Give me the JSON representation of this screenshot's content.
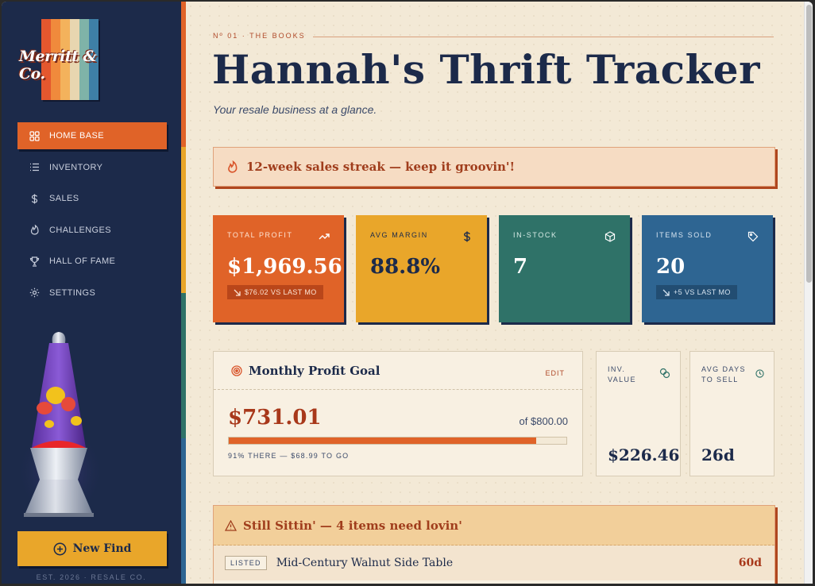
{
  "brand": {
    "logo_text": "Merritt & Co.",
    "logo_colors": [
      "#e4572e",
      "#f08a3c",
      "#f3b25c",
      "#e8d6b0",
      "#7fb3a8",
      "#3e7fa6"
    ],
    "tagline": "EST. 2026 · RESALE CO."
  },
  "colors": {
    "navy": "#1c2a4a",
    "orange": "#e06328",
    "mustard": "#e9a62a",
    "teal": "#2f7268",
    "blue": "#2e6592",
    "cream": "#f3e9d6",
    "rust": "#a8381a"
  },
  "nav": {
    "items": [
      {
        "label": "HOME BASE",
        "icon": "dashboard-icon",
        "active": true
      },
      {
        "label": "INVENTORY",
        "icon": "list-icon"
      },
      {
        "label": "SALES",
        "icon": "dollar-icon"
      },
      {
        "label": "CHALLENGES",
        "icon": "flame-icon"
      },
      {
        "label": "HALL OF FAME",
        "icon": "trophy-icon"
      },
      {
        "label": "SETTINGS",
        "icon": "gear-icon"
      }
    ],
    "new_find_label": "New Find"
  },
  "header": {
    "kicker": "Nº 01 · THE BOOKS",
    "title": "Hannah's Thrift Tracker",
    "subtitle": "Your resale business at a glance."
  },
  "streak": {
    "text": "12-week sales streak — keep it groovin'!"
  },
  "stats": [
    {
      "label": "TOTAL PROFIT",
      "value": "$1,969.56",
      "badge": "$76.02 VS LAST MO",
      "icon": "trend-up-icon"
    },
    {
      "label": "AVG MARGIN",
      "value": "88.8%",
      "icon": "dollar-icon"
    },
    {
      "label": "IN-STOCK",
      "value": "7",
      "icon": "box-icon"
    },
    {
      "label": "ITEMS SOLD",
      "value": "20",
      "badge": "+5 VS LAST MO",
      "icon": "tag-icon"
    }
  ],
  "goal": {
    "title": "Monthly Profit Goal",
    "edit_label": "EDIT",
    "amount": "$731.01",
    "target": "of $800.00",
    "progress_percent": 91,
    "note": "91% THERE — $68.99 TO GO"
  },
  "mini_stats": [
    {
      "label": "INV. VALUE",
      "value": "$226.46",
      "icon": "coins-icon"
    },
    {
      "label": "AVG DAYS TO SELL",
      "value": "26d",
      "icon": "clock-icon"
    }
  ],
  "sitting": {
    "title": "Still Sittin' — 4 items need lovin'",
    "rows": [
      {
        "tag": "LISTED",
        "name": "Mid-Century Walnut Side Table",
        "days": "60d"
      }
    ]
  }
}
